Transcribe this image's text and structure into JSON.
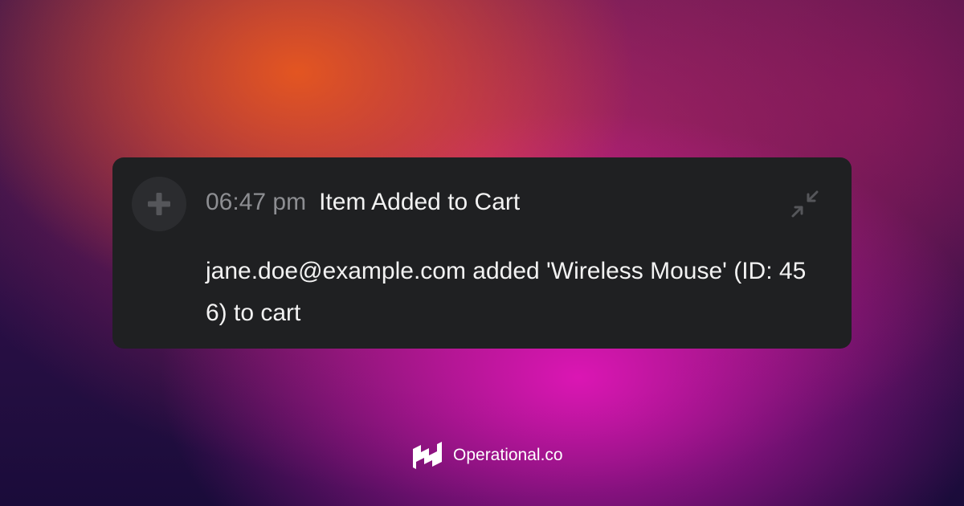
{
  "notification": {
    "icon": "plus-icon",
    "time": "06:47 pm",
    "title": "Item Added to Cart",
    "message": "jane.doe@example.com added 'Wireless Mouse' (ID: 456) to cart",
    "collapse_icon": "collapse-arrows-icon"
  },
  "brand": {
    "logo_icon": "operational-logo-icon",
    "name": "Operational.co"
  },
  "colors": {
    "card_background": "#1f2022",
    "avatar_background": "#2b2c2f",
    "time_text": "#8d8e92",
    "primary_text": "#f2f2f2",
    "icon_muted": "#55565a",
    "background_orange": "#e8581e",
    "background_magenta": "#e216b9",
    "background_deep": "#1a0c3a"
  }
}
